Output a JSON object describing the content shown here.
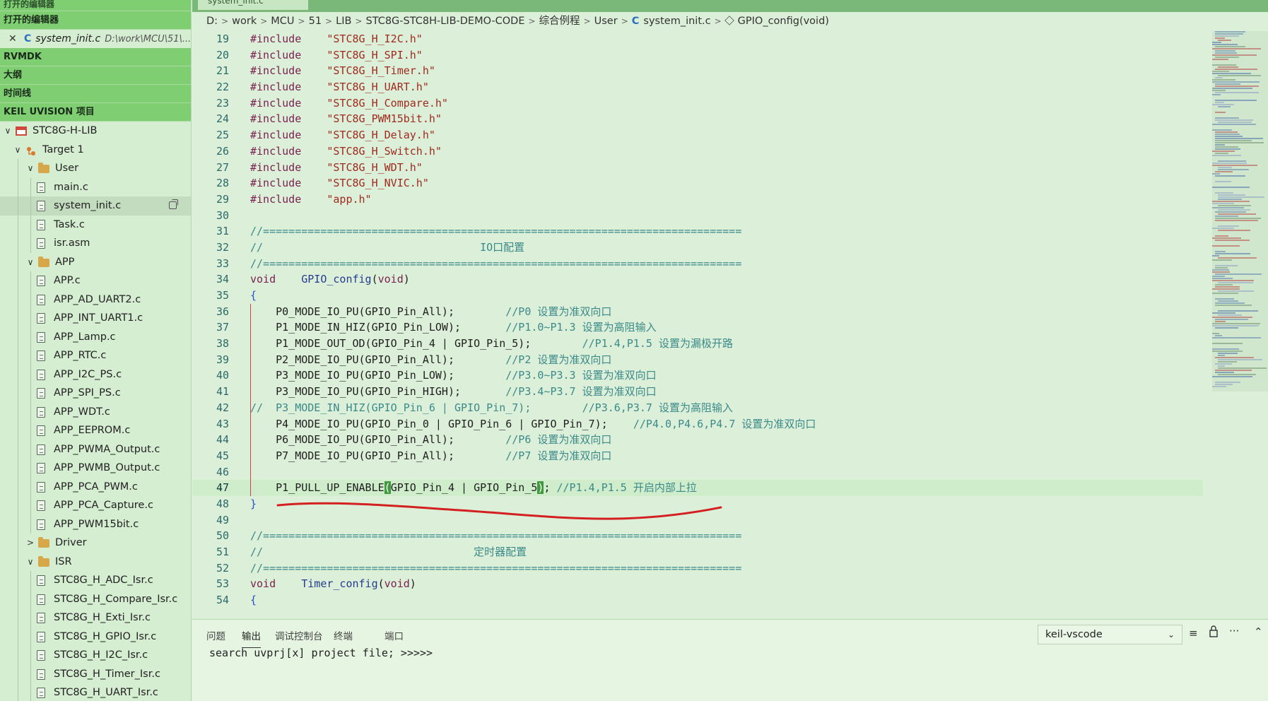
{
  "sidebar": {
    "top_header": "打开的编辑器",
    "open_editors_header": "打开的编辑器",
    "open_editor": {
      "close": "✕",
      "lang": "C",
      "name": "system_init.c",
      "path": "D:\\work\\MCU\\51\\..."
    },
    "rvmdk": "RVMDK",
    "outline": "大纲",
    "timeline": "时间线",
    "keil": "KEIL UVISION 项目",
    "tree": [
      {
        "label": "STC8G-H-LIB",
        "kind": "project",
        "level": 0,
        "chevron": "∨"
      },
      {
        "label": "Target 1",
        "kind": "target",
        "level": 1,
        "chevron": "∨"
      },
      {
        "label": "User",
        "kind": "folder",
        "level": 2,
        "chevron": "∨"
      },
      {
        "label": "main.c",
        "kind": "file",
        "level": 3
      },
      {
        "label": "system_init.c",
        "kind": "file",
        "level": 3,
        "selected": true
      },
      {
        "label": "Task.c",
        "kind": "file",
        "level": 3
      },
      {
        "label": "isr.asm",
        "kind": "file",
        "level": 3
      },
      {
        "label": "APP",
        "kind": "folder",
        "level": 2,
        "chevron": "∨"
      },
      {
        "label": "APP.c",
        "kind": "file",
        "level": 3
      },
      {
        "label": "APP_AD_UART2.c",
        "kind": "file",
        "level": 3
      },
      {
        "label": "APP_INT_UART1.c",
        "kind": "file",
        "level": 3
      },
      {
        "label": "APP_Lamp.c",
        "kind": "file",
        "level": 3
      },
      {
        "label": "APP_RTC.c",
        "kind": "file",
        "level": 3
      },
      {
        "label": "APP_I2C_PS.c",
        "kind": "file",
        "level": 3
      },
      {
        "label": "APP_SPI_PS.c",
        "kind": "file",
        "level": 3
      },
      {
        "label": "APP_WDT.c",
        "kind": "file",
        "level": 3
      },
      {
        "label": "APP_EEPROM.c",
        "kind": "file",
        "level": 3
      },
      {
        "label": "APP_PWMA_Output.c",
        "kind": "file",
        "level": 3
      },
      {
        "label": "APP_PWMB_Output.c",
        "kind": "file",
        "level": 3
      },
      {
        "label": "APP_PCA_PWM.c",
        "kind": "file",
        "level": 3
      },
      {
        "label": "APP_PCA_Capture.c",
        "kind": "file",
        "level": 3
      },
      {
        "label": "APP_PWM15bit.c",
        "kind": "file",
        "level": 3
      },
      {
        "label": "Driver",
        "kind": "folder",
        "level": 2,
        "chevron": ">"
      },
      {
        "label": "ISR",
        "kind": "folder",
        "level": 2,
        "chevron": "∨"
      },
      {
        "label": "STC8G_H_ADC_Isr.c",
        "kind": "file",
        "level": 3
      },
      {
        "label": "STC8G_H_Compare_Isr.c",
        "kind": "file",
        "level": 3
      },
      {
        "label": "STC8G_H_Exti_Isr.c",
        "kind": "file",
        "level": 3
      },
      {
        "label": "STC8G_H_GPIO_Isr.c",
        "kind": "file",
        "level": 3
      },
      {
        "label": "STC8G_H_I2C_Isr.c",
        "kind": "file",
        "level": 3
      },
      {
        "label": "STC8G_H_Timer_Isr.c",
        "kind": "file",
        "level": 3
      },
      {
        "label": "STC8G_H_UART_Isr.c",
        "kind": "file",
        "level": 3
      }
    ]
  },
  "editor": {
    "tab_label": "system_init.c",
    "breadcrumb": [
      "D:",
      "work",
      "MCU",
      "51",
      "LIB",
      "STC8G-STC8H-LIB-DEMO-CODE",
      "综合例程",
      "User"
    ],
    "breadcrumb_file": "system_init.c",
    "breadcrumb_symbol": "GPIO_config(void)",
    "lines": [
      {
        "n": "19",
        "segs": [
          [
            "kw",
            "#include"
          ],
          [
            "",
            "    "
          ],
          [
            "str",
            "\"STC8G_H_I2C.h\""
          ]
        ]
      },
      {
        "n": "20",
        "segs": [
          [
            "kw",
            "#include"
          ],
          [
            "",
            "    "
          ],
          [
            "str",
            "\"STC8G_H_SPI.h\""
          ]
        ]
      },
      {
        "n": "21",
        "segs": [
          [
            "kw",
            "#include"
          ],
          [
            "",
            "    "
          ],
          [
            "str",
            "\"STC8G_H_Timer.h\""
          ]
        ]
      },
      {
        "n": "22",
        "segs": [
          [
            "kw",
            "#include"
          ],
          [
            "",
            "    "
          ],
          [
            "str",
            "\"STC8G_H_UART.h\""
          ]
        ]
      },
      {
        "n": "23",
        "segs": [
          [
            "kw",
            "#include"
          ],
          [
            "",
            "    "
          ],
          [
            "str",
            "\"STC8G_H_Compare.h\""
          ]
        ]
      },
      {
        "n": "24",
        "segs": [
          [
            "kw",
            "#include"
          ],
          [
            "",
            "    "
          ],
          [
            "str",
            "\"STC8G_PWM15bit.h\""
          ]
        ]
      },
      {
        "n": "25",
        "segs": [
          [
            "kw",
            "#include"
          ],
          [
            "",
            "    "
          ],
          [
            "str",
            "\"STC8G_H_Delay.h\""
          ]
        ]
      },
      {
        "n": "26",
        "segs": [
          [
            "kw",
            "#include"
          ],
          [
            "",
            "    "
          ],
          [
            "str",
            "\"STC8G_H_Switch.h\""
          ]
        ]
      },
      {
        "n": "27",
        "segs": [
          [
            "kw",
            "#include"
          ],
          [
            "",
            "    "
          ],
          [
            "str",
            "\"STC8G_H_WDT.h\""
          ]
        ]
      },
      {
        "n": "28",
        "segs": [
          [
            "kw",
            "#include"
          ],
          [
            "",
            "    "
          ],
          [
            "str",
            "\"STC8G_H_NVIC.h\""
          ]
        ]
      },
      {
        "n": "29",
        "segs": [
          [
            "kw",
            "#include"
          ],
          [
            "",
            "    "
          ],
          [
            "str",
            "\"app.h\""
          ]
        ]
      },
      {
        "n": "30",
        "segs": []
      },
      {
        "n": "31",
        "segs": [
          [
            "cm",
            "//==========================================================================="
          ]
        ]
      },
      {
        "n": "32",
        "segs": [
          [
            "cm",
            "//                                  IO口配置"
          ]
        ]
      },
      {
        "n": "33",
        "segs": [
          [
            "cm",
            "//==========================================================================="
          ]
        ]
      },
      {
        "n": "34",
        "segs": [
          [
            "kw",
            "void"
          ],
          [
            "",
            "    "
          ],
          [
            "fn-c",
            "GPIO_config"
          ],
          [
            "",
            "("
          ],
          [
            "kw",
            "void"
          ],
          [
            "",
            ")"
          ]
        ]
      },
      {
        "n": "35",
        "segs": [
          [
            "br",
            "{"
          ]
        ]
      },
      {
        "n": "36",
        "segs": [
          [
            "",
            "    P0_MODE_IO_PU(GPIO_Pin_All);        "
          ],
          [
            "cm",
            "//P0 设置为准双向口"
          ]
        ]
      },
      {
        "n": "37",
        "segs": [
          [
            "",
            "    P1_MODE_IN_HIZ(GPIO_Pin_LOW);       "
          ],
          [
            "cm",
            "//P1.0~P1.3 设置为高阻输入"
          ]
        ]
      },
      {
        "n": "38",
        "segs": [
          [
            "",
            "    P1_MODE_OUT_OD(GPIO_Pin_4 | GPIO_Pin_5);        "
          ],
          [
            "cm",
            "//P1.4,P1.5 设置为漏极开路"
          ]
        ]
      },
      {
        "n": "39",
        "segs": [
          [
            "",
            "    P2_MODE_IO_PU(GPIO_Pin_All);        "
          ],
          [
            "cm",
            "//P2 设置为准双向口"
          ]
        ]
      },
      {
        "n": "40",
        "segs": [
          [
            "",
            "    P3_MODE_IO_PU(GPIO_Pin_LOW);        "
          ],
          [
            "cm",
            "//P3.0~P3.3 设置为准双向口"
          ]
        ]
      },
      {
        "n": "41",
        "segs": [
          [
            "",
            "    P3_MODE_IO_PU(GPIO_Pin_HIGH);       "
          ],
          [
            "cm",
            "//P3.4~P3.7 设置为准双向口"
          ]
        ]
      },
      {
        "n": "42",
        "segs": [
          [
            "cm",
            "//  P3_MODE_IN_HIZ(GPIO_Pin_6 | GPIO_Pin_7);        //P3.6,P3.7 设置为高阻输入"
          ]
        ]
      },
      {
        "n": "43",
        "segs": [
          [
            "",
            "    P4_MODE_IO_PU(GPIO_Pin_0 | GPIO_Pin_6 | GPIO_Pin_7);    "
          ],
          [
            "cm",
            "//P4.0,P4.6,P4.7 设置为准双向口"
          ]
        ]
      },
      {
        "n": "44",
        "segs": [
          [
            "",
            "    P6_MODE_IO_PU(GPIO_Pin_All);        "
          ],
          [
            "cm",
            "//P6 设置为准双向口"
          ]
        ]
      },
      {
        "n": "45",
        "segs": [
          [
            "",
            "    P7_MODE_IO_PU(GPIO_Pin_All);        "
          ],
          [
            "cm",
            "//P7 设置为准双向口"
          ]
        ]
      },
      {
        "n": "46",
        "segs": []
      },
      {
        "n": "47",
        "current": true,
        "segs": [
          [
            "",
            "    P1_PULL_UP_ENABLE"
          ],
          [
            "hl-br",
            "("
          ],
          [
            "",
            "GPIO_Pin_4 | GPIO_Pin_5"
          ],
          [
            "hl-br",
            ")"
          ],
          [
            "",
            "; "
          ],
          [
            "cm",
            "//P1.4,P1.5 开启内部上拉"
          ]
        ]
      },
      {
        "n": "48",
        "segs": [
          [
            "br",
            "}"
          ]
        ]
      },
      {
        "n": "49",
        "segs": []
      },
      {
        "n": "50",
        "segs": [
          [
            "cm",
            "//==========================================================================="
          ]
        ]
      },
      {
        "n": "51",
        "segs": [
          [
            "cm",
            "//                                 定时器配置"
          ]
        ]
      },
      {
        "n": "52",
        "segs": [
          [
            "cm",
            "//==========================================================================="
          ]
        ]
      },
      {
        "n": "53",
        "segs": [
          [
            "kw",
            "void"
          ],
          [
            "",
            "    "
          ],
          [
            "fn-c",
            "Timer_config"
          ],
          [
            "",
            "("
          ],
          [
            "kw",
            "void"
          ],
          [
            "",
            ")"
          ]
        ]
      },
      {
        "n": "54",
        "segs": [
          [
            "br",
            "{"
          ]
        ]
      }
    ]
  },
  "panel": {
    "tabs": [
      "问题",
      "输出",
      "调试控制台",
      "终端",
      "端口"
    ],
    "active_tab": "输出",
    "channel": "keil-vscode",
    "output": "search uvprj[x] project file; >>>>>",
    "icons": [
      "clear-output-icon",
      "lock-scroll-icon",
      "more-actions-icon",
      "maximize-panel-icon"
    ]
  },
  "colors": {
    "accent_header": "#7fcf72",
    "editor_bg": "#dcefd8",
    "annotation_red": "#d42020"
  }
}
